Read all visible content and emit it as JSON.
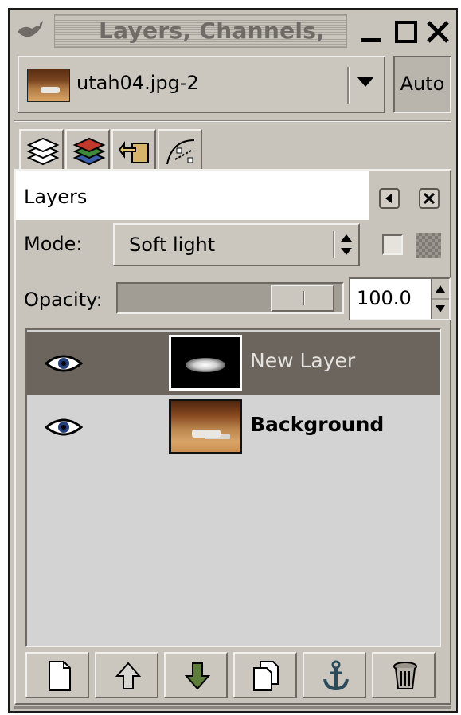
{
  "window": {
    "title": "Layers, Channels,",
    "buttons": [
      "minimize-icon",
      "maximize-icon",
      "close-icon"
    ]
  },
  "image_menu": {
    "selected": "utah04.jpg-2",
    "auto_label": "Auto"
  },
  "tabs": [
    {
      "name": "layers",
      "icon": "layers-icon",
      "active": true
    },
    {
      "name": "channels",
      "icon": "channels-icon",
      "active": false
    },
    {
      "name": "undo-history",
      "icon": "undo-history-icon",
      "active": false
    },
    {
      "name": "paths",
      "icon": "paths-icon",
      "active": false
    }
  ],
  "dockable": {
    "title": "Layers"
  },
  "mode": {
    "label": "Mode:",
    "value": "Soft light"
  },
  "opacity": {
    "label": "Opacity:",
    "value": "100.0",
    "fraction": 1.0
  },
  "layers": [
    {
      "name": "New Layer",
      "visible": true,
      "selected": true
    },
    {
      "name": "Background",
      "visible": true,
      "selected": false
    }
  ],
  "bottom_buttons": [
    {
      "name": "new-layer-button",
      "icon": "new-layer-icon"
    },
    {
      "name": "raise-layer-button",
      "icon": "raise-arrow-icon"
    },
    {
      "name": "lower-layer-button",
      "icon": "lower-arrow-icon"
    },
    {
      "name": "duplicate-layer-button",
      "icon": "duplicate-icon"
    },
    {
      "name": "anchor-layer-button",
      "icon": "anchor-icon"
    },
    {
      "name": "delete-layer-button",
      "icon": "trash-icon"
    }
  ],
  "colors": {
    "window_bg": "#c8c4bb",
    "selected_row": "#6b655e",
    "list_bg": "#d3d3d3",
    "lower_arrow_green": "#5e7d3a"
  }
}
